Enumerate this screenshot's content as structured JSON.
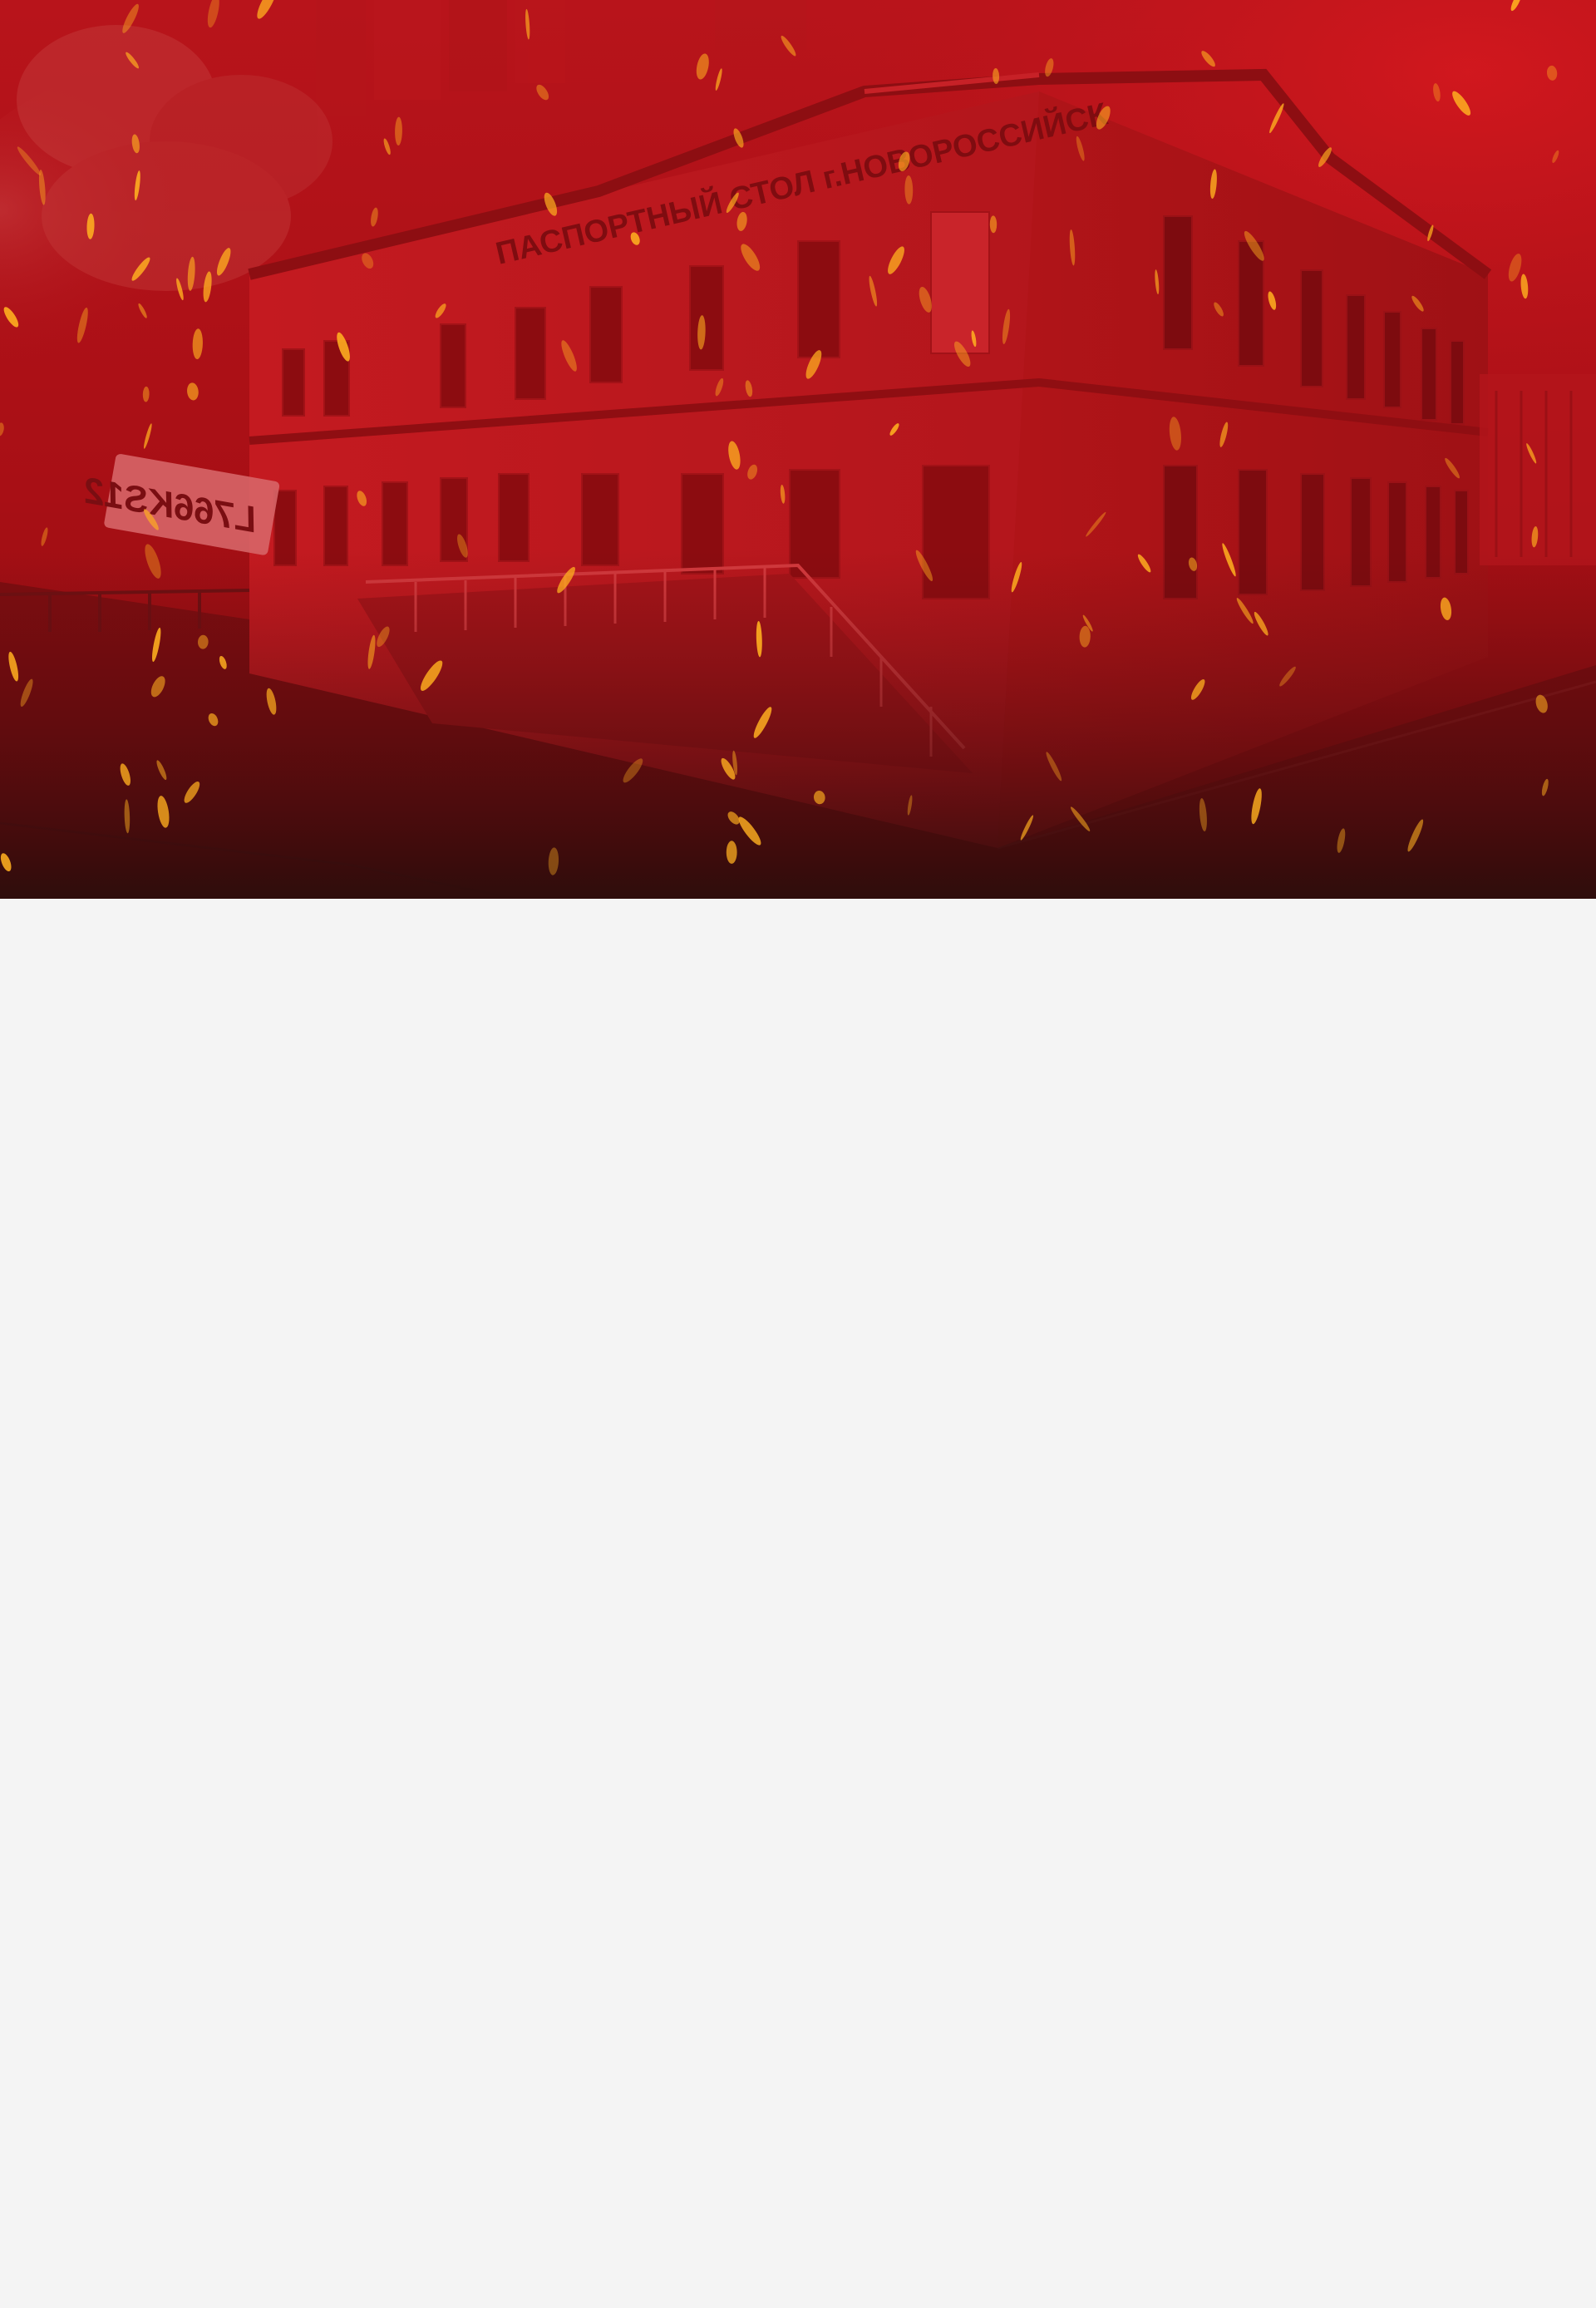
{
  "hero": {
    "building_sign": "ПАСПОРТНЫЙ СТОЛ  г.НОВОРОССИЙСК",
    "license_plate": "L766KS12",
    "colors": {
      "overlay": "#b3121a",
      "overlay_dark": "#5a0c0e",
      "spark": "#ffb020",
      "content_bg": "#f4f4f4"
    }
  }
}
